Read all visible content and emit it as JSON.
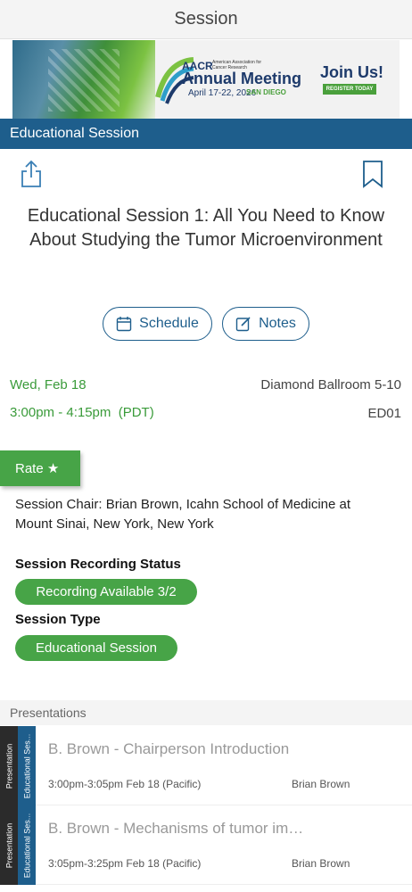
{
  "header": {
    "title": "Session"
  },
  "banner": {
    "org": "AACR",
    "org_sub": "American Association for Cancer Research",
    "event": "Annual Meeting",
    "dates": "April 17-22, 2026",
    "city": "SAN DIEGO",
    "cta": "Join Us!",
    "register": "REGISTER TODAY"
  },
  "category_bar": {
    "label": "Educational Session"
  },
  "actions": {
    "share_icon": "share-icon",
    "bookmark_icon": "bookmark-icon"
  },
  "session": {
    "title": "Educational Session 1: All You Need to Know About Studying the Tumor Microenvironment",
    "schedule_label": "Schedule",
    "notes_label": "Notes",
    "date": "Wed, Feb 18",
    "time": "3:00pm - 4:15pm  (PDT)",
    "location": "Diamond Ballroom 5-10",
    "code": "ED01",
    "rate_label": "Rate ★",
    "chair": "Session Chair: Brian Brown, Icahn School of Medicine at Mount Sinai, New York, New York",
    "recording_status_label": "Session Recording Status",
    "recording_status_value": "Recording Available 3/2",
    "type_label": "Session Type",
    "type_value": "Educational Session"
  },
  "presentations": {
    "header": "Presentations",
    "items": [
      {
        "tab1": "Presentation",
        "tab2": "Educational Ses...",
        "title": "B. Brown - Chairperson Introduction",
        "time": "3:00pm-3:05pm Feb 18 (Pacific)",
        "speaker": "Brian Brown"
      },
      {
        "tab1": "Presentation",
        "tab2": "Educational Ses...",
        "title": "B. Brown - Mechanisms of tumor im…",
        "time": "3:05pm-3:25pm Feb 18 (Pacific)",
        "speaker": "Brian Brown"
      }
    ]
  },
  "colors": {
    "brand_blue": "#1e5e8c",
    "green": "#47a447"
  }
}
